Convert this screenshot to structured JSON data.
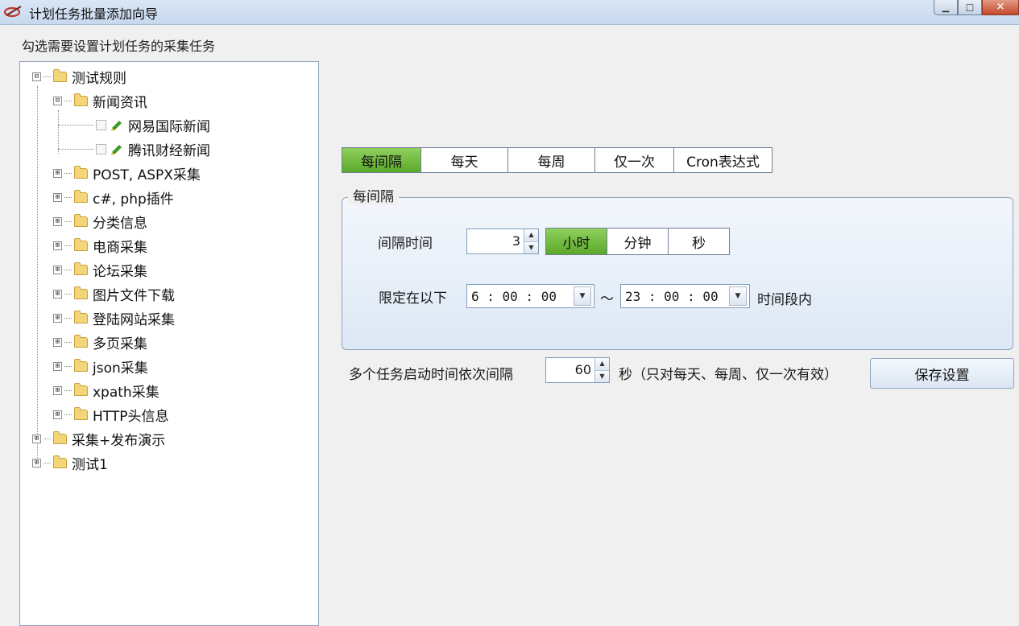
{
  "window": {
    "title": "计划任务批量添加向导",
    "controls": {
      "minimize_icon": "minimize-icon",
      "maximize_icon": "maximize-icon",
      "close_icon": "close-icon"
    }
  },
  "instructions": "勾选需要设置计划任务的采集任务",
  "tree": {
    "nodes": [
      {
        "label": "测试规则",
        "expander": "⊟"
      },
      {
        "label": "新闻资讯",
        "expander": "⊟"
      },
      {
        "label": "网易国际新闻",
        "checked": false,
        "icon": "pencil-icon"
      },
      {
        "label": "腾讯财经新闻",
        "checked": false,
        "icon": "pencil-icon"
      },
      {
        "label": "POST, ASPX采集",
        "expander": "⊞"
      },
      {
        "label": "c#, php插件",
        "expander": "⊞"
      },
      {
        "label": "分类信息",
        "expander": "⊞"
      },
      {
        "label": "电商采集",
        "expander": "⊞"
      },
      {
        "label": "论坛采集",
        "expander": "⊞"
      },
      {
        "label": "图片文件下载",
        "expander": "⊞"
      },
      {
        "label": "登陆网站采集",
        "expander": "⊞"
      },
      {
        "label": "多页采集",
        "expander": "⊞"
      },
      {
        "label": "json采集",
        "expander": "⊞"
      },
      {
        "label": "xpath采集",
        "expander": "⊞"
      },
      {
        "label": "HTTP头信息",
        "expander": "⊞"
      },
      {
        "label": "采集+发布演示",
        "expander": "⊞"
      },
      {
        "label": "测试1",
        "expander": "⊞"
      }
    ]
  },
  "schedule_tabs": [
    {
      "label": "每间隔",
      "active": true
    },
    {
      "label": "每天",
      "active": false
    },
    {
      "label": "每周",
      "active": false
    },
    {
      "label": "仅一次",
      "active": false
    },
    {
      "label": "Cron表达式",
      "active": false
    }
  ],
  "interval_group": {
    "legend": "每间隔",
    "interval_label": "间隔时间",
    "interval_value": "3",
    "units": [
      {
        "label": "小时",
        "active": true
      },
      {
        "label": "分钟",
        "active": false
      },
      {
        "label": "秒",
        "active": false
      }
    ],
    "limit_label": "限定在以下",
    "start_time": "6 : 00 : 00",
    "range_sep": "～",
    "end_time": "23 : 00 : 00",
    "range_suffix": "时间段内"
  },
  "stagger": {
    "label": "多个任务启动时间依次间隔",
    "value": "60",
    "unit_note": "秒（只对每天、每周、仅一次有效）"
  },
  "save_button": "保存设置",
  "colors": {
    "active_green": "#6cbb3c",
    "border_blue": "#8ea4bf",
    "folder_yellow": "#f4d67a"
  }
}
